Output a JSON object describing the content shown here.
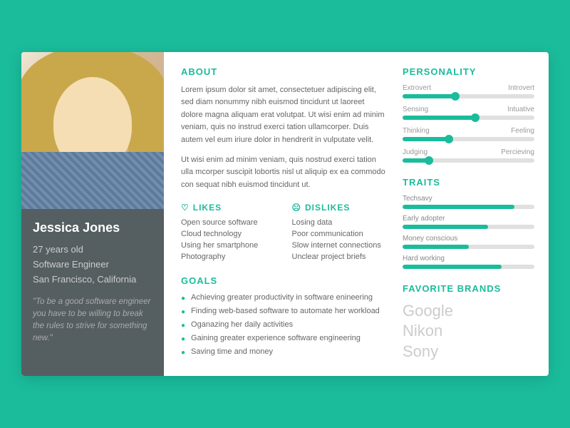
{
  "profile": {
    "name": "Jessica Jones",
    "age": "27 years old",
    "job": "Software Engineer",
    "location": "San Francisco, California",
    "quote": "\"To be a good software engineer you have to be willing to break the rules to strive for something new.\""
  },
  "about": {
    "title": "ABOUT",
    "para1": "Lorem ipsum dolor sit amet, consectetuer adipiscing elit, sed diam nonummy nibh euismod tincidunt ut laoreet dolore magna aliquam erat volutpat. Ut wisi enim ad minim veniam, quis no instrud exerci tation ullamcorper. Duis autem vel eum iriure dolor in hendrerit in vulputate velit.",
    "para2": "Ut wisi enim ad minim veniam, quis nostrud exerci tation ulla mcorper suscipit lobortis nisl ut aliquip ex ea commodo con sequat nibh euismod tincidunt ut."
  },
  "likes": {
    "title": "LIKES",
    "items": [
      "Open source software",
      "Cloud technology",
      "Using her smartphone",
      "Photography"
    ]
  },
  "dislikes": {
    "title": "DISLIKES",
    "items": [
      "Losing data",
      "Poor communication",
      "Slow internet connections",
      "Unclear project briefs"
    ]
  },
  "goals": {
    "title": "GOALS",
    "items": [
      "Achieving greater productivity in software enineering",
      "Finding web-based software to automate her workload",
      "Oganazing her daily activities",
      "Gaining greater experience software engineering",
      "Saving time and money"
    ]
  },
  "personality": {
    "title": "PERSONALITY",
    "sliders": [
      {
        "left": "Extrovert",
        "right": "Introvert",
        "position": 40
      },
      {
        "left": "Sensing",
        "right": "Intuative",
        "position": 55
      },
      {
        "left": "Thinking",
        "right": "Feeling",
        "position": 35
      },
      {
        "left": "Judging",
        "right": "Percieving",
        "position": 20
      }
    ]
  },
  "traits": {
    "title": "TRAITS",
    "items": [
      {
        "label": "Techsavy",
        "percent": 85
      },
      {
        "label": "Early adopter",
        "percent": 65
      },
      {
        "label": "Money conscious",
        "percent": 50
      },
      {
        "label": "Hard working",
        "percent": 75
      }
    ]
  },
  "brands": {
    "title": "FAVORITE BRANDS",
    "items": [
      "Google",
      "Nikon",
      "Sony"
    ]
  }
}
